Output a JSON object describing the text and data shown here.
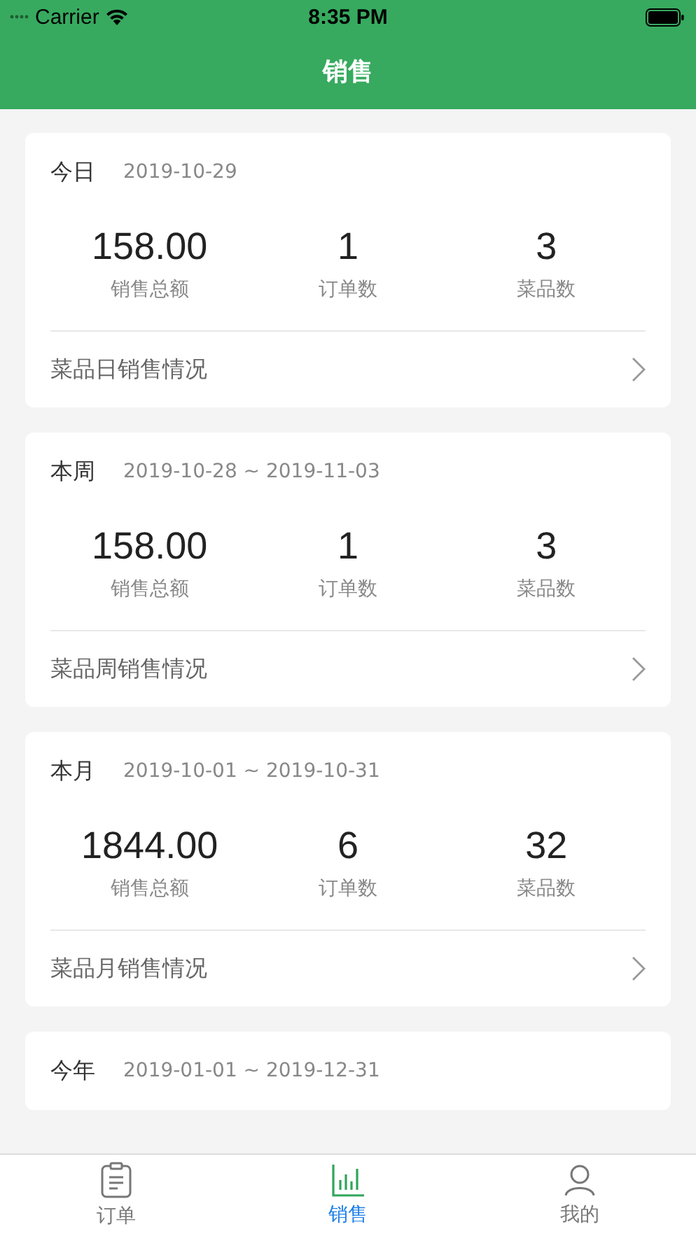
{
  "status_bar": {
    "carrier": "Carrier",
    "time": "8:35 PM"
  },
  "nav_bar": {
    "title": "销售"
  },
  "cards": [
    {
      "period": "今日",
      "range": "2019-10-29",
      "stats": [
        {
          "value": "158.00",
          "label": "销售总额"
        },
        {
          "value": "1",
          "label": "订单数"
        },
        {
          "value": "3",
          "label": "菜品数"
        }
      ],
      "link": "菜品日销售情况"
    },
    {
      "period": "本周",
      "range": "2019-10-28 ~ 2019-11-03",
      "stats": [
        {
          "value": "158.00",
          "label": "销售总额"
        },
        {
          "value": "1",
          "label": "订单数"
        },
        {
          "value": "3",
          "label": "菜品数"
        }
      ],
      "link": "菜品周销售情况"
    },
    {
      "period": "本月",
      "range": "2019-10-01 ~ 2019-10-31",
      "stats": [
        {
          "value": "1844.00",
          "label": "销售总额"
        },
        {
          "value": "6",
          "label": "订单数"
        },
        {
          "value": "32",
          "label": "菜品数"
        }
      ],
      "link": "菜品月销售情况"
    },
    {
      "period": "今年",
      "range": "2019-01-01 ~ 2019-12-31"
    }
  ],
  "tab_bar": [
    {
      "kind": "orders",
      "label": "订单",
      "selected": false
    },
    {
      "kind": "sales",
      "label": "销售",
      "selected": true
    },
    {
      "kind": "profile",
      "label": "我的",
      "selected": false
    }
  ]
}
